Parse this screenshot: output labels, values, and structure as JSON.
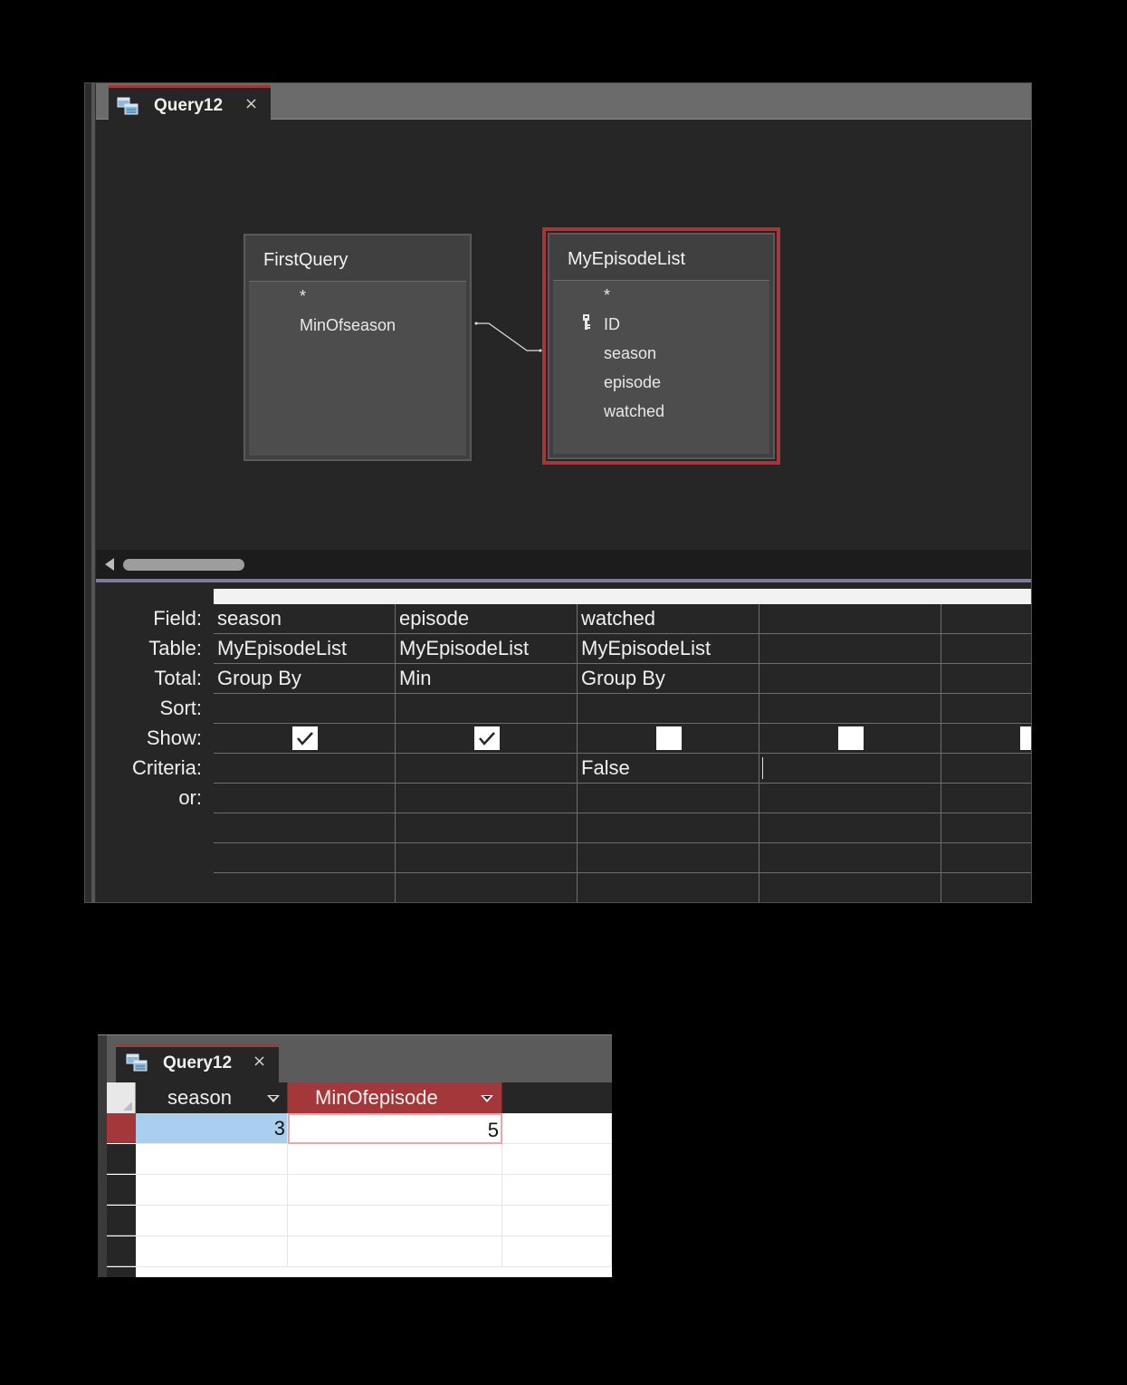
{
  "designer": {
    "tab_title": "Query12",
    "tab_close": "×",
    "tables": [
      {
        "name": "FirstQuery",
        "fields": [
          "*",
          "MinOfseason"
        ]
      },
      {
        "name": "MyEpisodeList",
        "fields": [
          "*",
          "ID",
          "season",
          "episode",
          "watched"
        ],
        "key_field": "ID"
      }
    ],
    "row_labels": [
      "Field:",
      "Table:",
      "Total:",
      "Sort:",
      "Show:",
      "Criteria:",
      "or:"
    ],
    "columns": [
      {
        "field": "season",
        "table": "MyEpisodeList",
        "total": "Group By",
        "sort": "",
        "show": true,
        "criteria": ""
      },
      {
        "field": "episode",
        "table": "MyEpisodeList",
        "total": "Min",
        "sort": "",
        "show": true,
        "criteria": ""
      },
      {
        "field": "watched",
        "table": "MyEpisodeList",
        "total": "Group By",
        "sort": "",
        "show": false,
        "criteria": "False"
      },
      {
        "field": "",
        "table": "",
        "total": "",
        "sort": "",
        "show": false,
        "criteria": ""
      },
      {
        "field": "",
        "table": "",
        "total": "",
        "sort": "",
        "show": false,
        "criteria": ""
      }
    ]
  },
  "datasheet": {
    "tab_title": "Query12",
    "tab_close": "×",
    "headers": [
      "season",
      "MinOfepisode"
    ],
    "rows": [
      [
        "3",
        "5"
      ]
    ]
  },
  "colors": {
    "accent": "#a4373a",
    "selected_cell": "#aacfee",
    "background": "#262626"
  }
}
